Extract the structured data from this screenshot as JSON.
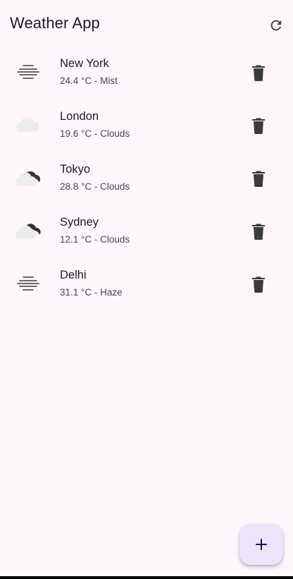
{
  "app": {
    "title": "Weather App"
  },
  "colors": {
    "background": "#fdf7fc",
    "fab_background": "#ece4f8",
    "fab_icon": "#21005d",
    "icon_dark": "#444444",
    "text_secondary": "#49454f"
  },
  "toolbar": {
    "refresh_icon": "refresh-icon"
  },
  "cities": [
    {
      "name": "New York",
      "detail": "24.4 °C - Mist",
      "icon": "mist-icon"
    },
    {
      "name": "London",
      "detail": "19.6 °C - Clouds",
      "icon": "cloud-icon"
    },
    {
      "name": "Tokyo",
      "detail": "28.8 °C - Clouds",
      "icon": "broken-clouds-icon"
    },
    {
      "name": "Sydney",
      "detail": "12.1 °C - Clouds",
      "icon": "broken-clouds-icon"
    },
    {
      "name": "Delhi",
      "detail": "31.1 °C - Haze",
      "icon": "mist-icon"
    }
  ],
  "actions": {
    "delete_icon": "trash-icon",
    "add_icon": "plus-icon"
  }
}
